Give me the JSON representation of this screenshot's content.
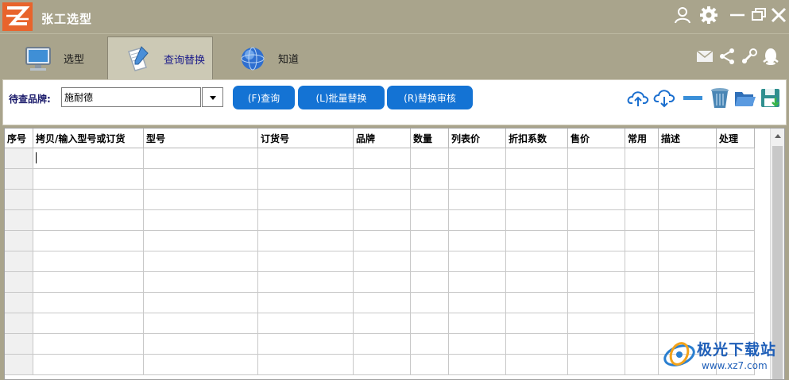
{
  "app": {
    "title": "张工选型"
  },
  "tabs": [
    {
      "label": "选型",
      "icon": "monitor-icon",
      "active": false
    },
    {
      "label": "查询替换",
      "icon": "document-pen-icon",
      "active": true
    },
    {
      "label": "知道",
      "icon": "globe-icon",
      "active": false
    }
  ],
  "query": {
    "brand_label": "待查品牌:",
    "brand_value": "施耐德",
    "buttons": [
      "(F)查询",
      "(L)批量替换",
      "(R)替换审核"
    ]
  },
  "table": {
    "columns": [
      "序号",
      "拷贝/输入型号或订货",
      "型号",
      "订货号",
      "品牌",
      "数量",
      "列表价",
      "折扣系数",
      "售价",
      "常用",
      "描述",
      "处理"
    ],
    "row_count": 11
  },
  "toolbar_icons": [
    "upload-cloud-icon",
    "download-cloud-icon",
    "minus-icon",
    "trash-icon",
    "open-folder-icon",
    "save-icon"
  ],
  "window_icons": [
    "user-icon",
    "settings-icon",
    "minimize-icon",
    "restore-icon",
    "close-icon"
  ],
  "share_icons": [
    "mail-icon",
    "share-icon",
    "weibo-icon",
    "qq-icon"
  ],
  "watermark": {
    "text": "极光下载站",
    "url": "www.xz7.com"
  },
  "colors": {
    "chrome": "#a9a48c",
    "active_tab": "#ccc9b5",
    "button": "#1473d4",
    "logo": "#e8642c",
    "accent_text": "#1c1c8a"
  }
}
